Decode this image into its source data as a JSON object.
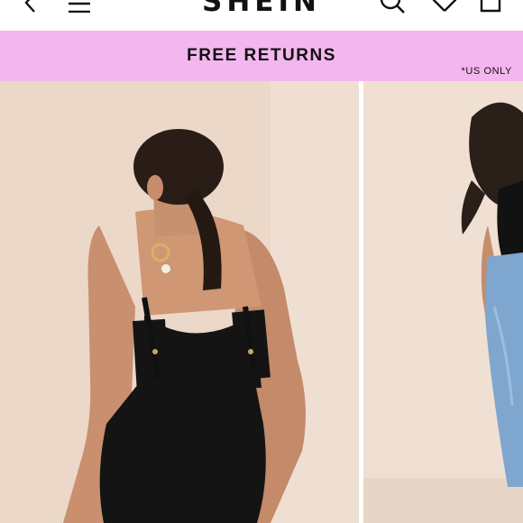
{
  "header": {
    "logo_text": "SHEIN",
    "icons": [
      "back-icon",
      "menu-icon",
      "search-icon",
      "heart-icon",
      "shopping-bag-icon"
    ]
  },
  "promo": {
    "text": "FREE RETURNS",
    "note": "*US ONLY",
    "background": "#f4b6ef"
  },
  "gallery": {
    "images": [
      "product-back-view-image",
      "product-front-view-image"
    ]
  }
}
